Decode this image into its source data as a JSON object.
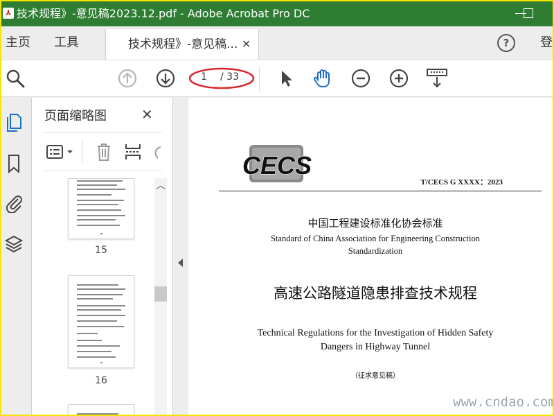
{
  "window": {
    "title": "技术规程》-意见稿2023.12.pdf - Adobe Acrobat Pro DC",
    "app_icon": "acrobat-icon",
    "title_color": "#2e7d32"
  },
  "nav": {
    "home": "主页",
    "tools": "工具",
    "doc_tab": "技术规程》-意见稿...",
    "close_glyph": "✕",
    "help_glyph": "?",
    "login": "登"
  },
  "toolbar": {
    "page_current": "1",
    "page_total": "/ 33",
    "annotation_color": "#d9262c"
  },
  "panel": {
    "title": "页面缩略图",
    "close_glyph": "✕",
    "thumbnails": [
      {
        "label": "15"
      },
      {
        "label": "16"
      }
    ]
  },
  "document": {
    "logo_text": "CECS",
    "standard_code": "T/CECS G XXXX：2023",
    "cn_standard": "中国工程建设标准化协会标准",
    "en_standard": "Standard of China Association for Engineering Construction Standardization",
    "cn_title": "高速公路隧道隐患排查技术规程",
    "en_title": "Technical Regulations for the Investigation of Hidden Safety Dangers in Highway Tunnel",
    "draft_note": "（征求意见稿）",
    "watermark": "www.cndao.com"
  }
}
